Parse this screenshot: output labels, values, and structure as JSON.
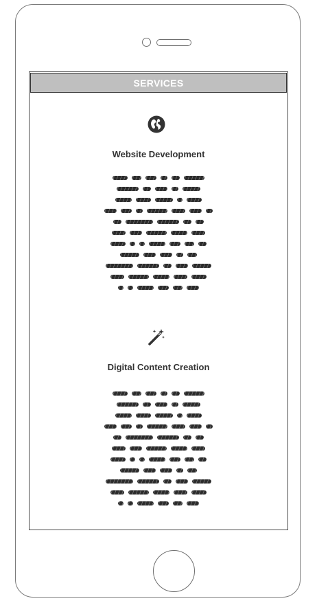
{
  "header": {
    "title": "SERVICES"
  },
  "services": [
    {
      "icon": "globe-icon",
      "title": "Website Development",
      "lines": [
        [
          22,
          14,
          16,
          10,
          12,
          30
        ],
        [
          32,
          12,
          18,
          10,
          26
        ],
        [
          24,
          22,
          26,
          8,
          22
        ],
        [
          18,
          16,
          10,
          30,
          20,
          18,
          10
        ],
        [
          12,
          40,
          32,
          12,
          12
        ],
        [
          20,
          18,
          30,
          24,
          20
        ],
        [
          22,
          8,
          8,
          24,
          16,
          14,
          12
        ],
        [
          28,
          18,
          18,
          10,
          14
        ],
        [
          40,
          32,
          12,
          18,
          28
        ],
        [
          20,
          30,
          24,
          20,
          22
        ],
        [
          8,
          8,
          24,
          16,
          14,
          18
        ]
      ]
    },
    {
      "icon": "magic-wand-icon",
      "title": "Digital Content Creation",
      "lines": [
        [
          22,
          14,
          16,
          10,
          12,
          30
        ],
        [
          32,
          12,
          18,
          10,
          26
        ],
        [
          24,
          22,
          26,
          8,
          22
        ],
        [
          18,
          16,
          10,
          30,
          20,
          18,
          10
        ],
        [
          12,
          40,
          32,
          12,
          12
        ],
        [
          20,
          18,
          30,
          24,
          20
        ],
        [
          22,
          8,
          8,
          24,
          16,
          14,
          12
        ],
        [
          28,
          18,
          18,
          10,
          14
        ],
        [
          40,
          32,
          12,
          18,
          28
        ],
        [
          20,
          30,
          24,
          20,
          22
        ],
        [
          8,
          8,
          24,
          16,
          14,
          18
        ]
      ]
    }
  ]
}
